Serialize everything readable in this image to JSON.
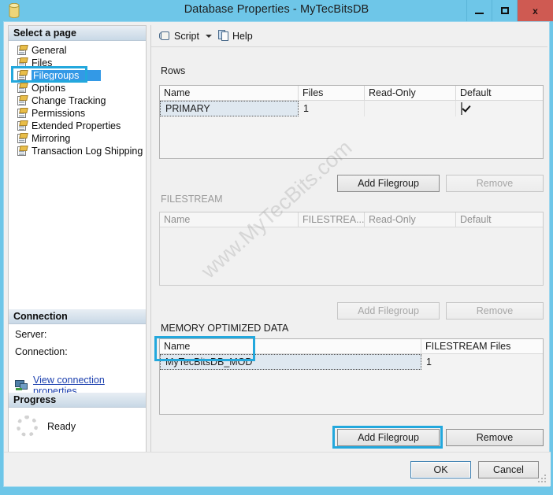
{
  "window": {
    "title": "Database Properties - MyTecBitsDB",
    "icon": "database-icon",
    "minimize_label": "Minimize",
    "maximize_label": "Maximize",
    "close_label": "x"
  },
  "sidebar": {
    "select_page_header": "Select a page",
    "items": [
      {
        "label": "General",
        "selected": false
      },
      {
        "label": "Files",
        "selected": false
      },
      {
        "label": "Filegroups",
        "selected": true
      },
      {
        "label": "Options",
        "selected": false
      },
      {
        "label": "Change Tracking",
        "selected": false
      },
      {
        "label": "Permissions",
        "selected": false
      },
      {
        "label": "Extended Properties",
        "selected": false
      },
      {
        "label": "Mirroring",
        "selected": false
      },
      {
        "label": "Transaction Log Shipping",
        "selected": false
      }
    ],
    "connection": {
      "header": "Connection",
      "server_label": "Server:",
      "server_value": "",
      "connection_label": "Connection:",
      "connection_value": "",
      "view_properties_link": "View connection properties"
    },
    "progress": {
      "header": "Progress",
      "status": "Ready"
    }
  },
  "toolbar": {
    "script_label": "Script",
    "help_label": "Help"
  },
  "sections": {
    "rows": {
      "label": "Rows",
      "columns": [
        "Name",
        "Files",
        "Read-Only",
        "Default"
      ],
      "rows": [
        {
          "name": "PRIMARY",
          "files": "1",
          "read_only": "",
          "default_checked": true
        }
      ],
      "add_button": "Add Filegroup",
      "remove_button": "Remove",
      "add_enabled": true,
      "remove_enabled": false
    },
    "filestream": {
      "label": "FILESTREAM",
      "columns": [
        "Name",
        "FILESTREA...",
        "Read-Only",
        "Default"
      ],
      "rows": [],
      "add_button": "Add Filegroup",
      "remove_button": "Remove",
      "add_enabled": false,
      "remove_enabled": false
    },
    "memory_optimized": {
      "label": "MEMORY OPTIMIZED DATA",
      "columns": [
        "Name",
        "FILESTREAM Files"
      ],
      "rows": [
        {
          "name": "MyTecBitsDB_MOD",
          "filestream_files": "1"
        }
      ],
      "add_button": "Add Filegroup",
      "remove_button": "Remove",
      "add_enabled": true,
      "remove_enabled": true
    }
  },
  "footer": {
    "ok_label": "OK",
    "cancel_label": "Cancel"
  },
  "watermark": {
    "text": "www.MyTecBits.com"
  },
  "colors": {
    "titlebar": "#6ec6e8",
    "close_button": "#cf5a52",
    "selection": "#3399e6",
    "annotation": "#23a8dd",
    "link": "#1b3fae"
  }
}
